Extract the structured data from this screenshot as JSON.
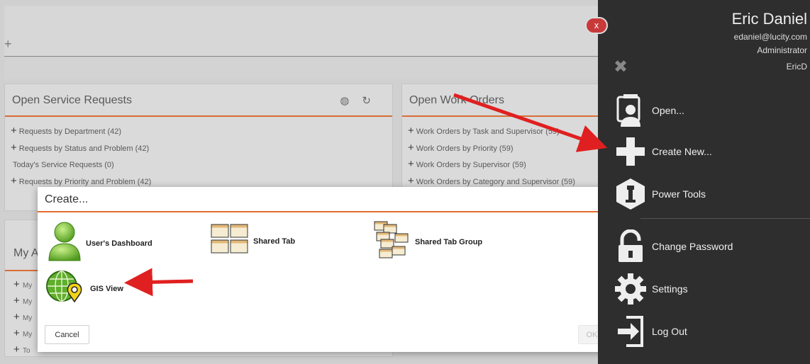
{
  "background": {
    "panel_left": {
      "title": "Open Service Requests",
      "rows": [
        {
          "plus": "+",
          "text": "Requests by Department (42)"
        },
        {
          "plus": "+",
          "text": "Requests by Status and Problem (42)"
        },
        {
          "plus": "",
          "text": "Today's Service Requests (0)"
        },
        {
          "plus": "+",
          "text": "Requests by Priority and Problem (42)"
        }
      ]
    },
    "panel_right": {
      "title": "Open Work Orders",
      "rows": [
        {
          "plus": "+",
          "text": "Work Orders by Task and Supervisor (59)"
        },
        {
          "plus": "+",
          "text": "Work Orders by Priority (59)"
        },
        {
          "plus": "+",
          "text": "Work Orders by Supervisor (59)"
        },
        {
          "plus": "+",
          "text": "Work Orders by Category and Supervisor (59)"
        }
      ]
    },
    "panel_mya": {
      "title": "My A",
      "rows": [
        "My",
        "My",
        "My",
        "My",
        "To"
      ]
    }
  },
  "modal": {
    "title": "Create...",
    "items": {
      "users_dashboard": "User's Dashboard",
      "shared_tab": "Shared Tab",
      "shared_tab_group": "Shared Tab Group",
      "gis_view": "GIS View"
    },
    "cancel_label": "Cancel",
    "ok_label": "OK"
  },
  "side_menu": {
    "close_label": "x",
    "user": {
      "name": "Eric Daniel",
      "email": "edaniel@lucity.com",
      "role": "Administrator",
      "id": "EricD"
    },
    "items": [
      {
        "label": "Open...",
        "icon": "folder-user-icon"
      },
      {
        "label": "Create New...",
        "icon": "plus-icon"
      },
      {
        "label": "Power Tools",
        "icon": "power-tools-icon"
      },
      {
        "label": "Change Password",
        "icon": "lock-icon"
      },
      {
        "label": "Settings",
        "icon": "gear-icon"
      },
      {
        "label": "Log Out",
        "icon": "logout-icon"
      }
    ]
  },
  "colors": {
    "accent": "#e46d2d",
    "side_bg": "#2e2e2e",
    "arrow": "#e02020",
    "close": "#c83a3a"
  }
}
